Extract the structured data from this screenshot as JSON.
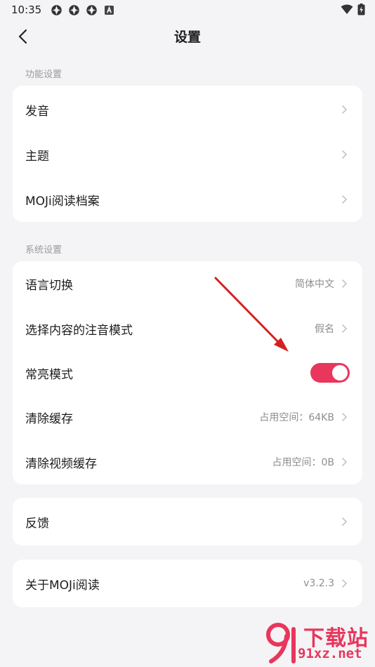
{
  "status_bar": {
    "time": "10:35",
    "icons": [
      "app-notification-icon",
      "app-notification-icon",
      "app-notification-icon",
      "keyboard-a-icon"
    ],
    "right_icons": [
      "wifi-icon",
      "battery-charging-icon"
    ]
  },
  "nav": {
    "title": "设置",
    "back_icon": "chevron-left-icon"
  },
  "sections": {
    "function": {
      "label": "功能设置",
      "items": [
        {
          "label": "发音"
        },
        {
          "label": "主题"
        },
        {
          "label": "MOJi阅读档案"
        }
      ]
    },
    "system": {
      "label": "系统设置",
      "items": [
        {
          "label": "语言切换",
          "value": "简体中文"
        },
        {
          "label": "选择内容的注音模式",
          "value": "假名"
        },
        {
          "label": "常亮模式",
          "toggle_on": true
        },
        {
          "label": "清除缓存",
          "value": "占用空间：64KB"
        },
        {
          "label": "清除视频缓存",
          "value": "占用空间：0B"
        }
      ]
    },
    "feedback": {
      "items": [
        {
          "label": "反馈"
        }
      ]
    },
    "about": {
      "items": [
        {
          "label": "关于MOJi阅读",
          "value": "v3.2.3"
        }
      ]
    }
  },
  "colors": {
    "accent": "#e8365d",
    "annotation_arrow": "#d42020",
    "background": "#f4f4f6",
    "card": "#ffffff"
  },
  "watermark": {
    "top_text": "下载站",
    "bottom_text": "91xz.net"
  }
}
